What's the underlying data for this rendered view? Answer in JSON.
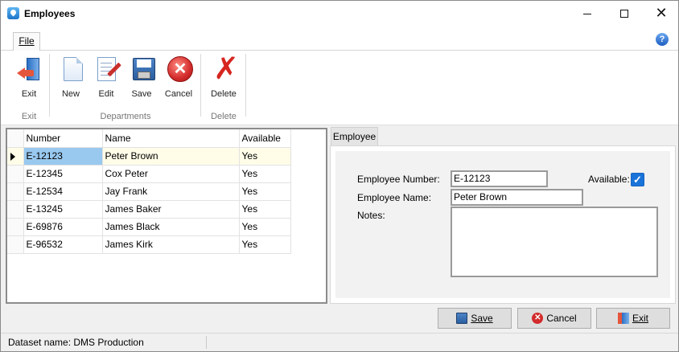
{
  "window": {
    "title": "Employees"
  },
  "ribbon": {
    "tab_file": "File",
    "buttons": {
      "exit": "Exit",
      "new": "New",
      "edit": "Edit",
      "save": "Save",
      "cancel": "Cancel",
      "delete": "Delete"
    },
    "groups": {
      "exit": "Exit",
      "departments": "Departments",
      "delete": "Delete"
    }
  },
  "grid": {
    "headers": {
      "number": "Number",
      "name": "Name",
      "available": "Available"
    },
    "rows": [
      {
        "number": "E-12123",
        "name": "Peter Brown",
        "available": "Yes"
      },
      {
        "number": "E-12345",
        "name": "Cox Peter",
        "available": "Yes"
      },
      {
        "number": "E-12534",
        "name": "Jay Frank",
        "available": "Yes"
      },
      {
        "number": "E-13245",
        "name": "James Baker",
        "available": "Yes"
      },
      {
        "number": "E-69876",
        "name": "James Black",
        "available": "Yes"
      },
      {
        "number": "E-96532",
        "name": "James Kirk",
        "available": "Yes"
      }
    ],
    "selected_row": 0
  },
  "detail": {
    "tab": "Employee",
    "employee_number_label": "Employee Number:",
    "employee_number": "E-12123",
    "employee_name_label": "Employee Name:",
    "employee_name": "Peter Brown",
    "notes_label": "Notes:",
    "notes": "",
    "available_label": "Available:",
    "available_checked": true
  },
  "actions": {
    "save": "Save",
    "cancel": "Cancel",
    "exit": "Exit"
  },
  "status": {
    "dataset": "Dataset name:  DMS Production"
  },
  "colors": {
    "selected_cell": "#99c9ef",
    "selected_row": "#fffde8",
    "checkbox": "#1a73d9"
  }
}
